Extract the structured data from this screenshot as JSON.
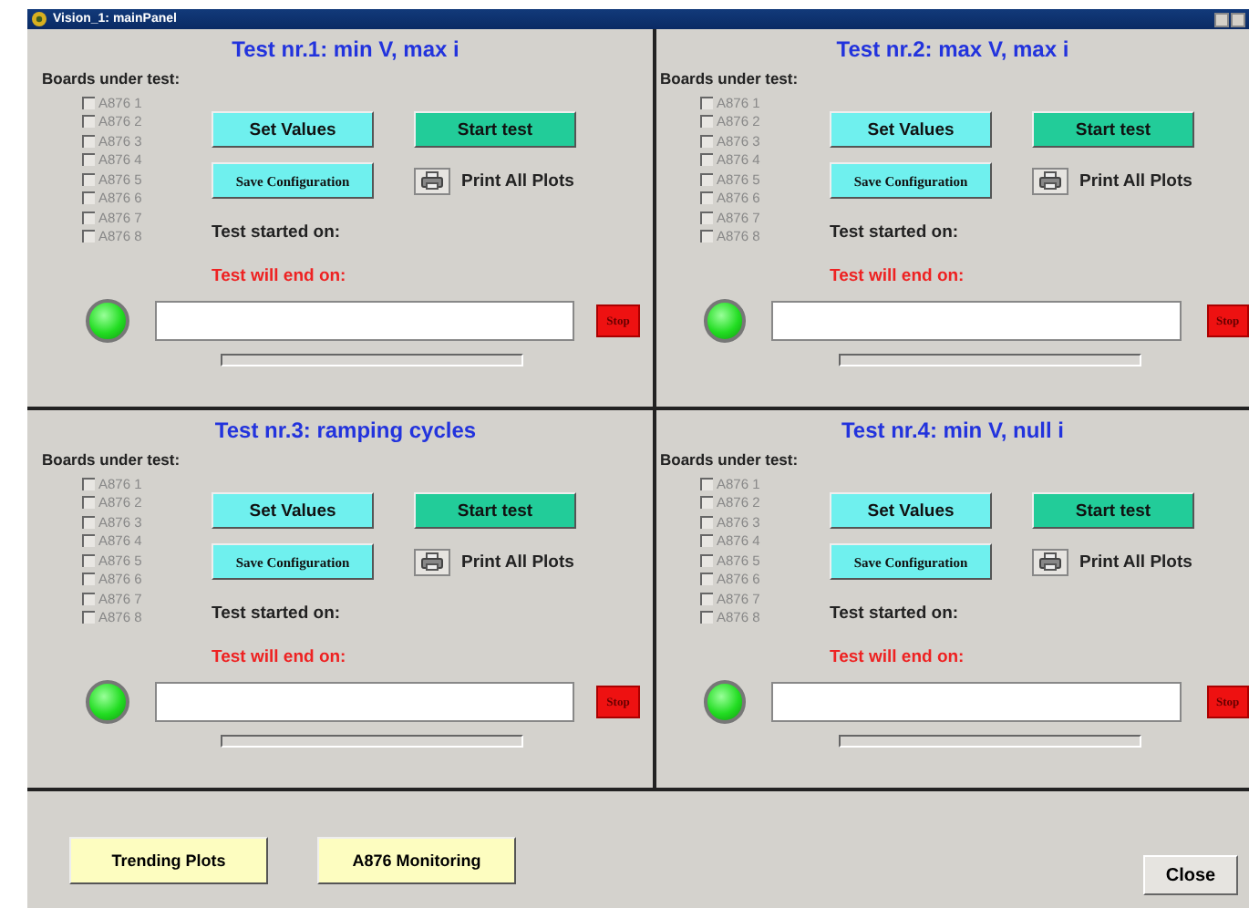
{
  "window": {
    "title": "Vision_1: mainPanel"
  },
  "panels": [
    {
      "title": "Test nr.1: min V, max i",
      "boards_label": "Boards under test:",
      "boards": [
        {
          "label": "A876 1",
          "checked": false
        },
        {
          "label": "A876 2",
          "checked": false
        },
        {
          "label": "A876 3",
          "checked": false
        },
        {
          "label": "A876 4",
          "checked": false
        },
        {
          "label": "A876 5",
          "checked": false
        },
        {
          "label": "A876 6",
          "checked": false
        },
        {
          "label": "A876 7",
          "checked": false
        },
        {
          "label": "A876 8",
          "checked": false
        }
      ],
      "set_values": "Set Values",
      "start": "Start test",
      "save": "Save Configuration",
      "print": "Print All Plots",
      "started": "Test started on:",
      "end": "Test will end on:",
      "stop": "Stop"
    },
    {
      "title": "Test nr.2: max V, max i",
      "boards_label": "Boards under test:",
      "boards": [
        {
          "label": "A876 1",
          "checked": false
        },
        {
          "label": "A876 2",
          "checked": false
        },
        {
          "label": "A876 3",
          "checked": false
        },
        {
          "label": "A876 4",
          "checked": false
        },
        {
          "label": "A876 5",
          "checked": false
        },
        {
          "label": "A876 6",
          "checked": false
        },
        {
          "label": "A876 7",
          "checked": false
        },
        {
          "label": "A876 8",
          "checked": false
        }
      ],
      "set_values": "Set Values",
      "start": "Start test",
      "save": "Save Configuration",
      "print": "Print All Plots",
      "started": "Test started on:",
      "end": "Test will end on:",
      "stop": "Stop"
    },
    {
      "title": "Test nr.3: ramping cycles",
      "boards_label": "Boards under test:",
      "boards": [
        {
          "label": "A876 1",
          "checked": false
        },
        {
          "label": "A876 2",
          "checked": false
        },
        {
          "label": "A876 3",
          "checked": false
        },
        {
          "label": "A876 4",
          "checked": false
        },
        {
          "label": "A876 5",
          "checked": false
        },
        {
          "label": "A876 6",
          "checked": false
        },
        {
          "label": "A876 7",
          "checked": false
        },
        {
          "label": "A876 8",
          "checked": false
        }
      ],
      "set_values": "Set Values",
      "start": "Start test",
      "save": "Save Configuration",
      "print": "Print All Plots",
      "started": "Test started on:",
      "end": "Test will end on:",
      "stop": "Stop"
    },
    {
      "title": "Test nr.4: min V, null i",
      "boards_label": "Boards under test:",
      "boards": [
        {
          "label": "A876 1",
          "checked": false
        },
        {
          "label": "A876 2",
          "checked": false
        },
        {
          "label": "A876 3",
          "checked": false
        },
        {
          "label": "A876 4",
          "checked": false
        },
        {
          "label": "A876 5",
          "checked": false
        },
        {
          "label": "A876 6",
          "checked": false
        },
        {
          "label": "A876 7",
          "checked": false
        },
        {
          "label": "A876 8",
          "checked": false
        }
      ],
      "set_values": "Set Values",
      "start": "Start test",
      "save": "Save Configuration",
      "print": "Print All Plots",
      "started": "Test started on:",
      "end": "Test will end on:",
      "stop": "Stop"
    }
  ],
  "footer": {
    "buttons": [
      "Trending Plots",
      "A876 Monitoring"
    ],
    "close": "Close"
  }
}
